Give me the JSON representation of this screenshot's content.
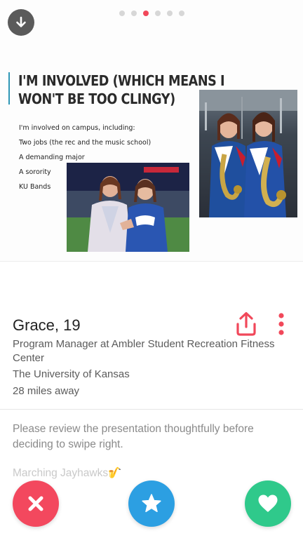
{
  "photo": {
    "pagination": {
      "total": 6,
      "active_index": 2
    },
    "slide": {
      "title": "I'M INVOLVED (WHICH MEANS I WON'T BE TOO CLINGY)",
      "list": [
        "I'm involved on campus, including:",
        "Two jobs (the rec and the music school)",
        "A demanding major",
        "A sorority",
        "KU Bands"
      ],
      "accent_color": "#2f97b6"
    },
    "icons": {
      "back": "down-arrow-icon"
    }
  },
  "profile": {
    "name": "Grace",
    "age": ", 19",
    "job": "Program Manager at Ambler Student Recreation Fitness Center",
    "school": "The University of Kansas",
    "distance": "28 miles away",
    "bio": "Please review the presentation thoughtfully before deciding to swipe right.",
    "extra": "Marching Jayhawks🎷"
  },
  "actions": {
    "nope": {
      "icon": "close-icon",
      "color": "#f3485e"
    },
    "super_like": {
      "icon": "star-icon",
      "color": "#2c9fe2"
    },
    "like": {
      "icon": "heart-icon",
      "color": "#2fc98b"
    }
  },
  "colors": {
    "brand_accent": "#f1485a"
  }
}
